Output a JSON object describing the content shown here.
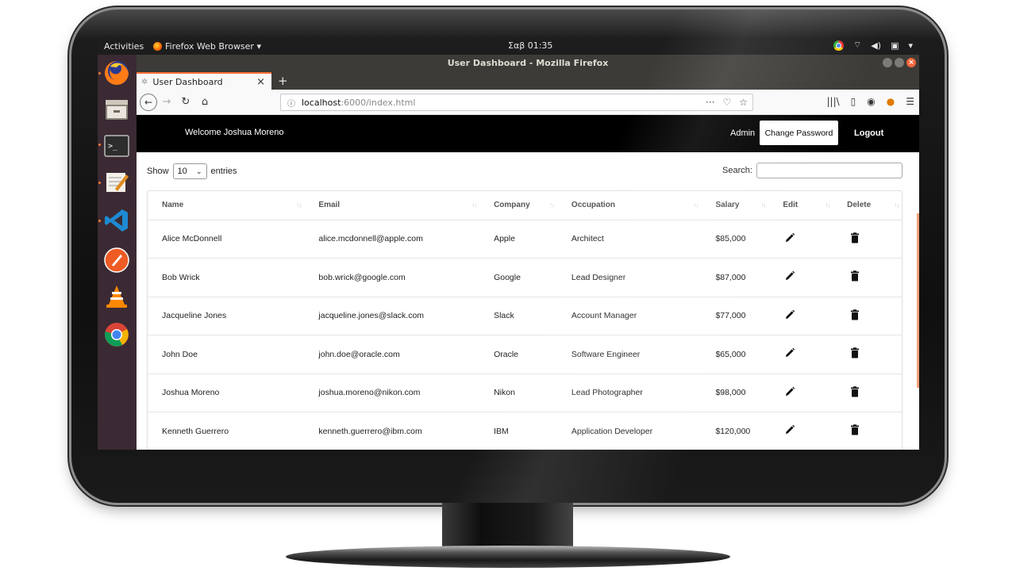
{
  "system": {
    "activities": "Activities",
    "app_menu": "Firefox Web Browser ▾",
    "clock": "Σαβ 01:35"
  },
  "browser": {
    "window_title": "User Dashboard - Mozilla Firefox",
    "tab_title": "User Dashboard",
    "url_host": "localhost",
    "url_rest": ":6000/index.html",
    "accent_color": "#ff7139"
  },
  "header": {
    "welcome": "Welcome Joshua Moreno",
    "role": "Admin",
    "change_password": "Change Password",
    "logout": "Logout"
  },
  "controls": {
    "show_label": "Show",
    "entries_value": "10",
    "entries_label": "entries",
    "search_label": "Search:"
  },
  "table": {
    "columns": [
      "Name",
      "Email",
      "Company",
      "Occupation",
      "Salary",
      "Edit",
      "Delete"
    ],
    "rows": [
      {
        "name": "Alice McDonnell",
        "email": "alice.mcdonnell@apple.com",
        "company": "Apple",
        "occupation": "Architect",
        "salary": "$85,000"
      },
      {
        "name": "Bob Wrick",
        "email": "bob.wrick@google.com",
        "company": "Google",
        "occupation": "Lead Designer",
        "salary": "$87,000"
      },
      {
        "name": "Jacqueline Jones",
        "email": "jacqueline.jones@slack.com",
        "company": "Slack",
        "occupation": "Account Manager",
        "salary": "$77,000"
      },
      {
        "name": "John Doe",
        "email": "john.doe@oracle.com",
        "company": "Oracle",
        "occupation": "Software Engineer",
        "salary": "$65,000"
      },
      {
        "name": "Joshua Moreno",
        "email": "joshua.moreno@nikon.com",
        "company": "Nikon",
        "occupation": "Lead Photographer",
        "salary": "$98,000"
      },
      {
        "name": "Kenneth Guerrero",
        "email": "kenneth.guerrero@ibm.com",
        "company": "IBM",
        "occupation": "Application Developer",
        "salary": "$120,000"
      }
    ]
  },
  "dock": {
    "apps": [
      "firefox-icon",
      "files-icon",
      "terminal-icon",
      "text-editor-icon",
      "vscode-icon",
      "postman-icon",
      "vlc-icon",
      "chrome-icon"
    ]
  }
}
